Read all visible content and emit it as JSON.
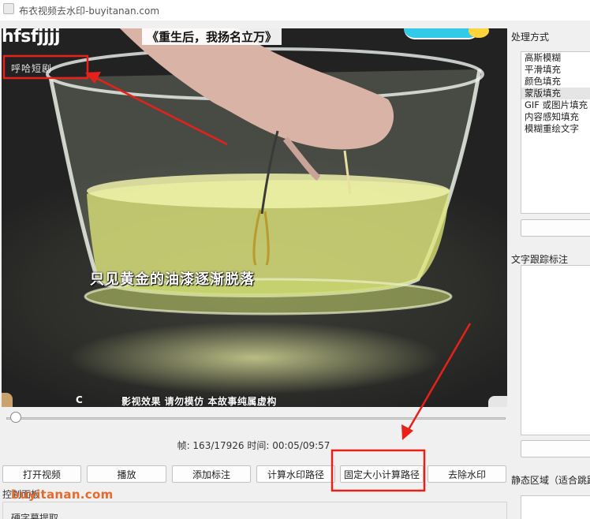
{
  "window": {
    "title": "布衣视频去水印-buyitanan.com"
  },
  "video": {
    "top_overlay_text": "hfsfjjjj",
    "top_title": "《重生后，我扬名立万》",
    "watermark_text": "呼哈短剧",
    "subtitle": "只见黄金的油漆逐渐脱落",
    "bottom_letter": "C",
    "disclaimer": "影视效果 请勿模仿 本故事纯属虚构"
  },
  "playback": {
    "status_text": "帧: 163/17926  时间: 00:05/09:57",
    "progress": 0.009
  },
  "buttons": {
    "open_video": "打开视频",
    "play": "播放",
    "add_marker": "添加标注",
    "compute_path": "计算水印路径",
    "fixed_size_path": "固定大小计算路径",
    "remove_watermark": "去除水印"
  },
  "control_panel": {
    "title": "控制面板",
    "hard_subtitle": "硬字幕提取",
    "site_watermark": "buyitanan.com"
  },
  "right_panel": {
    "method_label": "处理方式",
    "methods": [
      "高斯模糊",
      "平滑填充",
      "颜色填充",
      "蒙版填充",
      "GIF 或图片填充",
      "内容感知填充",
      "模糊重绘文字"
    ],
    "selected_index": 3,
    "tracking_label": "文字跟踪标注",
    "static_label": "静态区域（适合跳跃"
  },
  "colors": {
    "annotation_red": "#e8201a",
    "site_watermark": "#e56a2e",
    "selection_bg": "#e5e5e5"
  }
}
